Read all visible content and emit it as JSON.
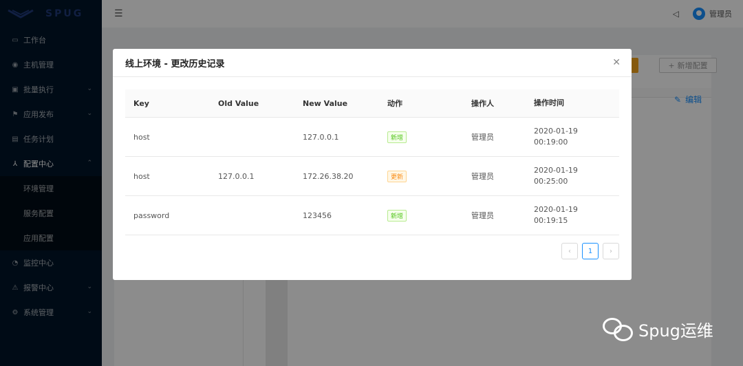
{
  "app": {
    "logo_text": "SPUG"
  },
  "sidebar": {
    "items": [
      {
        "label": "工作台",
        "icon": "desktop-icon"
      },
      {
        "label": "主机管理",
        "icon": "eye-icon"
      },
      {
        "label": "批量执行",
        "icon": "terminal-icon",
        "has_arrow": true
      },
      {
        "label": "应用发布",
        "icon": "flag-icon",
        "has_arrow": true
      },
      {
        "label": "任务计划",
        "icon": "calendar-icon"
      },
      {
        "label": "配置中心",
        "icon": "cluster-icon",
        "has_arrow": true,
        "expanded": true
      },
      {
        "label": "监控中心",
        "icon": "monitor-icon"
      },
      {
        "label": "报警中心",
        "icon": "alert-icon",
        "has_arrow": true
      },
      {
        "label": "系统管理",
        "icon": "setting-icon",
        "has_arrow": true
      }
    ],
    "submenu": [
      {
        "label": "环境管理"
      },
      {
        "label": "服务配置"
      },
      {
        "label": "应用配置"
      }
    ]
  },
  "header": {
    "username": "管理员"
  },
  "background": {
    "add_config_label": "新增配置",
    "edit_label": "编辑"
  },
  "modal": {
    "title": "线上环境 - 更改历史记录",
    "columns": [
      "Key",
      "Old Value",
      "New Value",
      "动作",
      "操作人",
      "操作时间"
    ],
    "rows": [
      {
        "key": "host",
        "old": "",
        "new": "127.0.0.1",
        "action": "新增",
        "action_type": "add",
        "operator": "管理员",
        "date": "2020-01-19",
        "time": "00:19:00"
      },
      {
        "key": "host",
        "old": "127.0.0.1",
        "new": "172.26.38.20",
        "action": "更新",
        "action_type": "update",
        "operator": "管理员",
        "date": "2020-01-19",
        "time": "00:25:00"
      },
      {
        "key": "password",
        "old": "",
        "new": "123456",
        "action": "新增",
        "action_type": "add",
        "operator": "管理员",
        "date": "2020-01-19",
        "time": "00:19:15"
      }
    ],
    "pagination": {
      "current_page": "1",
      "prev_icon": "chevron-left-icon",
      "next_icon": "chevron-right-icon"
    }
  },
  "watermark": {
    "text": "Spug运维"
  },
  "colors": {
    "sidebar_bg": "#001529",
    "primary": "#1890ff",
    "tag_add": "#52c41a",
    "tag_update": "#fa8c16",
    "warning_btn": "#f4a51c"
  }
}
